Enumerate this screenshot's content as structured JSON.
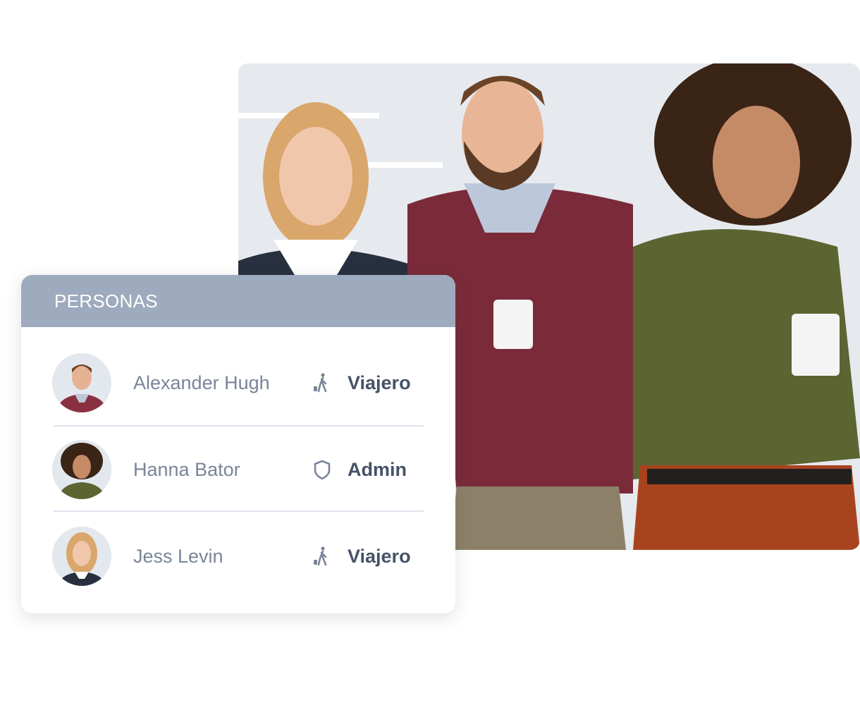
{
  "card": {
    "title": "PERSONAS",
    "people": [
      {
        "name": "Alexander Hugh",
        "role": "Viajero",
        "role_icon": "traveler-icon"
      },
      {
        "name": "Hanna Bator",
        "role": "Admin",
        "role_icon": "shield-icon"
      },
      {
        "name": "Jess Levin",
        "role": "Viajero",
        "role_icon": "traveler-icon"
      }
    ]
  },
  "colors": {
    "header": "#9eaabd",
    "name_text": "#7a8599",
    "role_text": "#475268",
    "divider": "#dde3ee"
  }
}
